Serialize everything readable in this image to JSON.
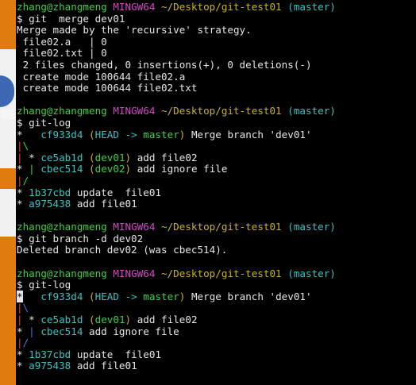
{
  "colors": {
    "background": "#000000",
    "text": "#e6e6e6",
    "green": "#3fd13f",
    "magenta": "#d544c9",
    "yellow": "#c8b21f",
    "cyan": "#3ac2c2",
    "red": "#e0432f",
    "blue": "#4b70e8",
    "strip_orange": "#e07b10"
  },
  "lines": [
    {
      "name": "prompt-line-1",
      "segments": [
        {
          "t": "zhang@zhangmeng ",
          "c": "green"
        },
        {
          "t": "MINGW64 ",
          "c": "magenta"
        },
        {
          "t": "~/Desktop/git-test01 ",
          "c": "yellow"
        },
        {
          "t": "(master)",
          "c": "cyan"
        }
      ]
    },
    {
      "name": "command-line-merge",
      "segments": [
        {
          "t": "$ git  merge dev01",
          "c": "white"
        }
      ]
    },
    {
      "name": "output-line",
      "segments": [
        {
          "t": "Merge made by the 'recursive' strategy.",
          "c": "white"
        }
      ]
    },
    {
      "name": "output-line",
      "segments": [
        {
          "t": " file02.a   | 0",
          "c": "white"
        }
      ]
    },
    {
      "name": "output-line",
      "segments": [
        {
          "t": " file02.txt | 0",
          "c": "white"
        }
      ]
    },
    {
      "name": "output-line",
      "segments": [
        {
          "t": " 2 files changed, 0 insertions(+), 0 deletions(-)",
          "c": "white"
        }
      ]
    },
    {
      "name": "output-line",
      "segments": [
        {
          "t": " create mode 100644 file02.a",
          "c": "white"
        }
      ]
    },
    {
      "name": "output-line",
      "segments": [
        {
          "t": " create mode 100644 file02.txt",
          "c": "white"
        }
      ]
    },
    {
      "name": "blank-line",
      "segments": []
    },
    {
      "name": "prompt-line-2",
      "segments": [
        {
          "t": "zhang@zhangmeng ",
          "c": "green"
        },
        {
          "t": "MINGW64 ",
          "c": "magenta"
        },
        {
          "t": "~/Desktop/git-test01 ",
          "c": "yellow"
        },
        {
          "t": "(master)",
          "c": "cyan"
        }
      ]
    },
    {
      "name": "command-line-git-log",
      "segments": [
        {
          "t": "$ git-log",
          "c": "white"
        }
      ]
    },
    {
      "name": "log-line",
      "segments": [
        {
          "t": "*   ",
          "c": "white"
        },
        {
          "t": "cf933d4 ",
          "c": "cyan"
        },
        {
          "t": "(",
          "c": "yellow"
        },
        {
          "t": "HEAD -> ",
          "c": "cyan"
        },
        {
          "t": "master",
          "c": "green"
        },
        {
          "t": ") ",
          "c": "yellow"
        },
        {
          "t": "Merge branch 'dev01'",
          "c": "white"
        }
      ]
    },
    {
      "name": "log-line",
      "segments": [
        {
          "t": "|",
          "c": "red"
        },
        {
          "t": "\\",
          "c": "green"
        }
      ]
    },
    {
      "name": "log-line",
      "segments": [
        {
          "t": "| ",
          "c": "red"
        },
        {
          "t": "* ",
          "c": "white"
        },
        {
          "t": "ce5ab1d ",
          "c": "cyan"
        },
        {
          "t": "(",
          "c": "yellow"
        },
        {
          "t": "dev01",
          "c": "green"
        },
        {
          "t": ") ",
          "c": "yellow"
        },
        {
          "t": "add file02",
          "c": "white"
        }
      ]
    },
    {
      "name": "log-line",
      "segments": [
        {
          "t": "* ",
          "c": "white"
        },
        {
          "t": "| ",
          "c": "green"
        },
        {
          "t": "cbec514 ",
          "c": "cyan"
        },
        {
          "t": "(",
          "c": "yellow"
        },
        {
          "t": "dev02",
          "c": "green"
        },
        {
          "t": ") ",
          "c": "yellow"
        },
        {
          "t": "add ignore file",
          "c": "white"
        }
      ]
    },
    {
      "name": "log-line",
      "segments": [
        {
          "t": "|",
          "c": "red"
        },
        {
          "t": "/",
          "c": "green"
        }
      ]
    },
    {
      "name": "log-line",
      "segments": [
        {
          "t": "* ",
          "c": "white"
        },
        {
          "t": "1b37cbd ",
          "c": "cyan"
        },
        {
          "t": "update  file01",
          "c": "white"
        }
      ]
    },
    {
      "name": "log-line",
      "segments": [
        {
          "t": "* ",
          "c": "white"
        },
        {
          "t": "a975438 ",
          "c": "cyan"
        },
        {
          "t": "add file01",
          "c": "white"
        }
      ]
    },
    {
      "name": "blank-line",
      "segments": []
    },
    {
      "name": "prompt-line-3",
      "segments": [
        {
          "t": "zhang@zhangmeng ",
          "c": "green"
        },
        {
          "t": "MINGW64 ",
          "c": "magenta"
        },
        {
          "t": "~/Desktop/git-test01 ",
          "c": "yellow"
        },
        {
          "t": "(master)",
          "c": "cyan"
        }
      ]
    },
    {
      "name": "command-line-branch-delete",
      "segments": [
        {
          "t": "$ git branch -d dev02",
          "c": "white"
        }
      ]
    },
    {
      "name": "output-line",
      "segments": [
        {
          "t": "Deleted branch dev02 (was cbec514).",
          "c": "white"
        }
      ]
    },
    {
      "name": "blank-line",
      "segments": []
    },
    {
      "name": "prompt-line-4",
      "segments": [
        {
          "t": "zhang@zhangmeng ",
          "c": "green"
        },
        {
          "t": "MINGW64 ",
          "c": "magenta"
        },
        {
          "t": "~/Desktop/git-test01 ",
          "c": "yellow"
        },
        {
          "t": "(master)",
          "c": "cyan"
        }
      ]
    },
    {
      "name": "command-line-git-log",
      "segments": [
        {
          "t": "$ git-log",
          "c": "white"
        }
      ]
    },
    {
      "name": "log-line",
      "segments": [
        {
          "t": "*",
          "c": "cursor"
        },
        {
          "t": "   ",
          "c": "white"
        },
        {
          "t": "cf933d4 ",
          "c": "cyan"
        },
        {
          "t": "(",
          "c": "yellow"
        },
        {
          "t": "HEAD -> ",
          "c": "cyan"
        },
        {
          "t": "master",
          "c": "green"
        },
        {
          "t": ") ",
          "c": "yellow"
        },
        {
          "t": "Merge branch 'dev01'",
          "c": "white"
        }
      ]
    },
    {
      "name": "log-line",
      "segments": [
        {
          "t": "|",
          "c": "red"
        },
        {
          "t": "\\",
          "c": "blue"
        }
      ]
    },
    {
      "name": "log-line",
      "segments": [
        {
          "t": "| ",
          "c": "red"
        },
        {
          "t": "* ",
          "c": "white"
        },
        {
          "t": "ce5ab1d ",
          "c": "cyan"
        },
        {
          "t": "(",
          "c": "yellow"
        },
        {
          "t": "dev01",
          "c": "green"
        },
        {
          "t": ") ",
          "c": "yellow"
        },
        {
          "t": "add file02",
          "c": "white"
        }
      ]
    },
    {
      "name": "log-line",
      "segments": [
        {
          "t": "* ",
          "c": "white"
        },
        {
          "t": "| ",
          "c": "blue"
        },
        {
          "t": "cbec514 ",
          "c": "cyan"
        },
        {
          "t": "add ignore file",
          "c": "white"
        }
      ]
    },
    {
      "name": "log-line",
      "segments": [
        {
          "t": "|",
          "c": "red"
        },
        {
          "t": "/",
          "c": "blue"
        }
      ]
    },
    {
      "name": "log-line",
      "segments": [
        {
          "t": "* ",
          "c": "white"
        },
        {
          "t": "1b37cbd ",
          "c": "cyan"
        },
        {
          "t": "update  file01",
          "c": "white"
        }
      ]
    },
    {
      "name": "log-line",
      "segments": [
        {
          "t": "* ",
          "c": "white"
        },
        {
          "t": "a975438 ",
          "c": "cyan"
        },
        {
          "t": "add file01",
          "c": "white"
        }
      ]
    }
  ]
}
